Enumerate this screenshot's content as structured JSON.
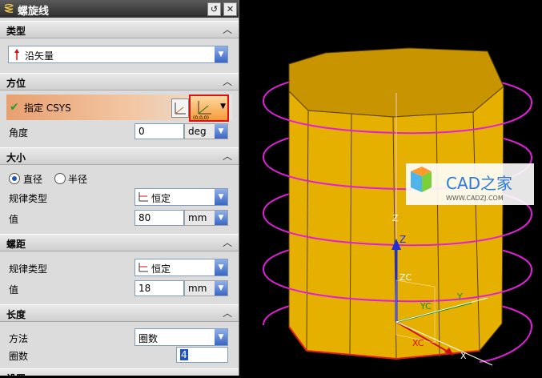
{
  "dialog": {
    "title": "螺旋线",
    "title_icon": "helix-icon",
    "reset_icon": "reset-icon",
    "close_icon": "close-icon"
  },
  "sections": {
    "type": {
      "label": "类型",
      "value": "沿矢量",
      "icon": "vector-arrow-icon"
    },
    "orientation": {
      "label": "方位",
      "specify_csys": "指定 CSYS",
      "angle_label": "角度",
      "angle_value": "0",
      "angle_unit": "deg"
    },
    "size": {
      "label": "大小",
      "radio_diameter": "直径",
      "radio_radius": "半径",
      "selected": "直径",
      "law_type_label": "规律类型",
      "law_type_value": "恒定",
      "value_label": "值",
      "value": "80",
      "unit": "mm"
    },
    "pitch": {
      "label": "螺距",
      "law_type_label": "规律类型",
      "law_type_value": "恒定",
      "value_label": "值",
      "value": "18",
      "unit": "mm"
    },
    "length": {
      "label": "长度",
      "method_label": "方法",
      "method_value": "圈数",
      "turns_label": "圈数",
      "turns_value": "4"
    },
    "settings": {
      "label": "设置"
    }
  },
  "viewport": {
    "watermark_title": "CAD之家",
    "watermark_url": "WWW.CADZJ.COM",
    "axis_z": "Z",
    "axis_zc": "ZC",
    "axis_yc": "YC",
    "axis_xc": "XC",
    "axis_y": "Y",
    "axis_x": "X",
    "colors": {
      "solid": "#e6b000",
      "helix": "#e020d8",
      "background": "#000000"
    }
  }
}
